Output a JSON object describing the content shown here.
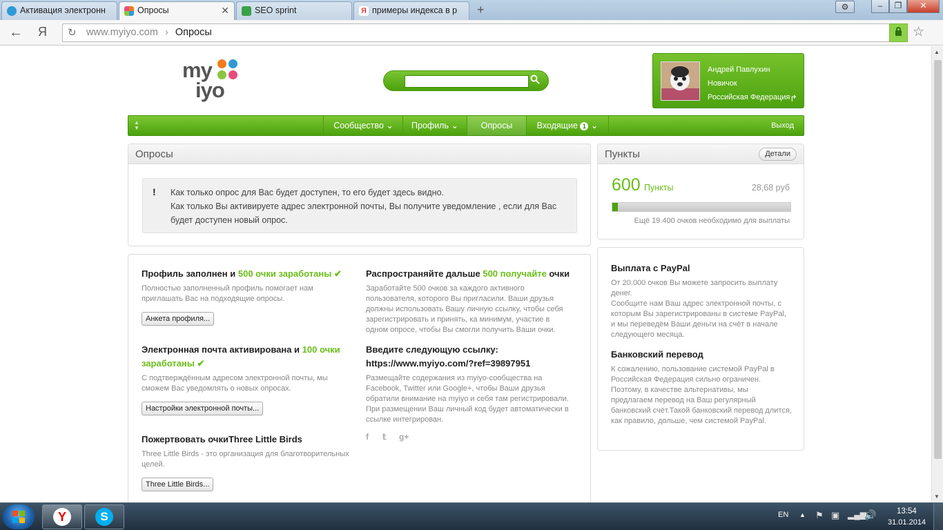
{
  "browser": {
    "tabs": [
      {
        "label": "Активация электронн",
        "active": false
      },
      {
        "label": "Опросы",
        "active": true
      },
      {
        "label": "SEO sprint",
        "active": false
      },
      {
        "label": "примеры индекса в р",
        "active": false
      }
    ],
    "new_tab": "+",
    "nav": {
      "back": "←",
      "yandex": "Я",
      "reload": "↻"
    },
    "url_domain": "www.myiyo.com",
    "url_sep": "›",
    "url_page": "Опросы"
  },
  "site": {
    "logo_top": "my",
    "logo_bottom": "iyo",
    "logo_colors": [
      "#f07d1e",
      "#2e9ad6",
      "#8bc53f",
      "#e84c7d"
    ],
    "search": {
      "value": "",
      "icon": "search-icon"
    },
    "user": {
      "name": "Андрей Павлухин",
      "level": "Новичок",
      "country": "Российская Федерация"
    },
    "nav": {
      "items": [
        "Сообщество",
        "Профиль",
        "Опросы",
        "Входящие"
      ],
      "inbox_count": "1",
      "logout": "Выход"
    }
  },
  "surveys": {
    "title": "Опросы",
    "notice_line1": "Как только опрос для Вас будет доступен, то его будет здесь видно.",
    "notice_line2": "Как только Вы активируете адрес электронной почты, Вы получите уведомление , если для Вас будет доступен новый опрос.",
    "notice_mark": "!"
  },
  "tasks": {
    "profile": {
      "title_a": "Профиль заполнен и ",
      "title_b": "500 очки заработаны",
      "desc": "Полностью заполненный профиль помогает нам приглашать Вас на подходящие опросы.",
      "button": "Анкета профиля..."
    },
    "email": {
      "title_a": "Электронная почта активирована и ",
      "title_b": "100 очки заработаны",
      "desc": "С подтверждённым адресом электронной почты, мы сможем Вас уведомлять о новых опросах.",
      "button": "Настройки электронной почты..."
    },
    "donate": {
      "title": "Пожертвовать очкиThree Little Birds",
      "desc": "Three Little Birds - это организация для благотворительных целей.",
      "button": "Three Little Birds..."
    },
    "spread": {
      "title_a": "Распространяйте дальше ",
      "title_b": "500 получайте",
      "title_c": " очки",
      "desc": "Заработайте 500 очков за каждого активного пользователя, которого Вы пригласили. Ваши друзья должны использовать Вашу личную ссылку, чтобы себя зарегистрировать и принять, ка минимум, участие в одном опросе, чтобы Вы смогли получить Ваши очки."
    },
    "link": {
      "title": "Введите следующую ссылку:",
      "url": "https://www.myiyo.com/?ref=39897951",
      "desc": "Размещайте содержания из myiyo-сообщества на Facebook, Twitter или Google+, чтобы Ваши друзья обратили внимание на myiyo и себя там регистрировали. При размещении Ваш личный код будет автоматически в ссылке интегрирован."
    },
    "check": "✔"
  },
  "points": {
    "title": "Пункты",
    "details": "Детали",
    "value": "600",
    "unit": "Пункты",
    "money": "28,68 руб",
    "progress_fraction": 0.03,
    "note": "Ещё 19.400 очков необходимо для выплаты"
  },
  "payout": {
    "paypal_title": "Выплата с PayPal",
    "paypal_text": "От 20.000 очков Вы можете запросить выплату денег.\nСообщите нам Ваш адрес электронной почты, с которым Вы зарегистрированы в системе PayPal, и мы переведём Ваши деньги на счёт в начале следующего месяца.",
    "bank_title": "Банковский перевод",
    "bank_text": "К сожалению, пользование системой PayPal в Российская Федерация сильно ограничен. Поэтому, в качестве альтернативы, мы предлагаем перевод на Ваш регулярный банковский счёт.Такой банковский перевод длится, как правило, дольше, чем системой PayPal."
  },
  "taskbar": {
    "lang": "EN",
    "time": "13:54",
    "date": "31.01.2014"
  }
}
